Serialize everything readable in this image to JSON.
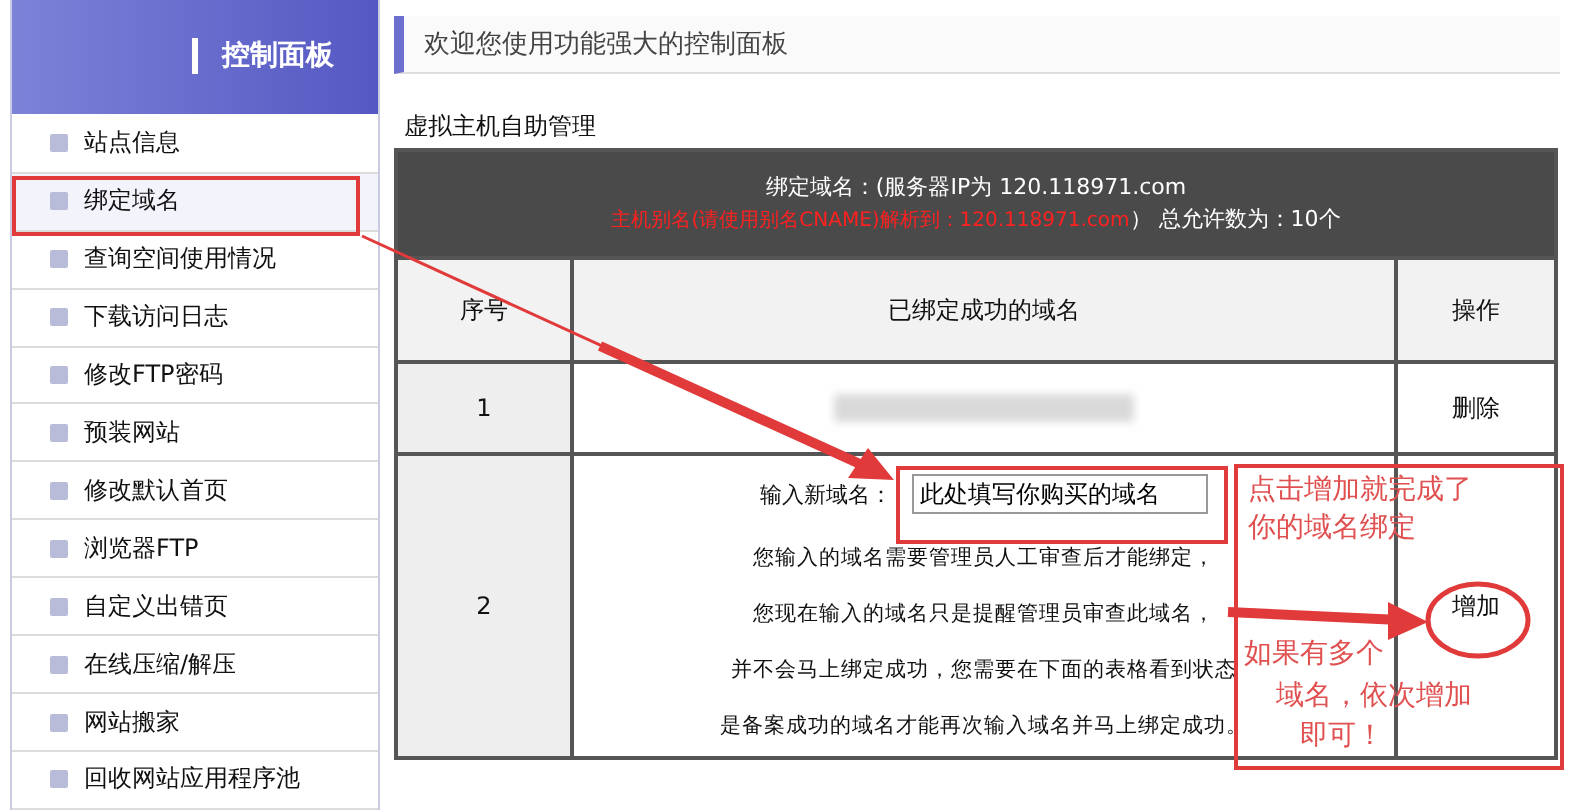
{
  "sidebar": {
    "title": "控制面板",
    "items": [
      {
        "label": "站点信息",
        "selected": false
      },
      {
        "label": "绑定域名",
        "selected": true
      },
      {
        "label": "查询空间使用情况",
        "selected": false
      },
      {
        "label": "下载访问日志",
        "selected": false
      },
      {
        "label": "修改FTP密码",
        "selected": false
      },
      {
        "label": "预装网站",
        "selected": false
      },
      {
        "label": "修改默认首页",
        "selected": false
      },
      {
        "label": "浏览器FTP",
        "selected": false
      },
      {
        "label": "自定义出错页",
        "selected": false
      },
      {
        "label": "在线压缩/解压",
        "selected": false
      },
      {
        "label": "网站搬家",
        "selected": false
      },
      {
        "label": "回收网站应用程序池",
        "selected": false
      }
    ]
  },
  "page_title": "欢迎您使用功能强大的控制面板",
  "section_title": "虚拟主机自助管理",
  "table": {
    "banner_line1": "绑定域名：(服务器IP为 120.118971.com",
    "banner_alias": "主机别名(请使用别名CNAME)解析到：120.118971.com",
    "banner_tail": "）  总允许数为：10个",
    "columns": [
      "序号",
      "已绑定成功的域名",
      "操作"
    ],
    "rows": [
      {
        "number": "1",
        "kind": "existing",
        "action": "删除"
      },
      {
        "number": "2",
        "kind": "new",
        "label": "输入新域名：",
        "value": "此处填写你购买的域名",
        "notes": [
          "您输入的域名需要管理员人工审查后才能绑定，",
          "您现在输入的域名只是提醒管理员审查此域名，",
          "并不会马上绑定成功，您需要在下面的表格看到状态",
          "是备案成功的域名才能再次输入域名并马上绑定成功。"
        ],
        "action": "增加"
      }
    ]
  },
  "annotations": {
    "note1": "点击增加就完成了你的域名绑定",
    "note2": "如果有多个",
    "note3": "域名，依次增加",
    "note4": "即可！"
  }
}
